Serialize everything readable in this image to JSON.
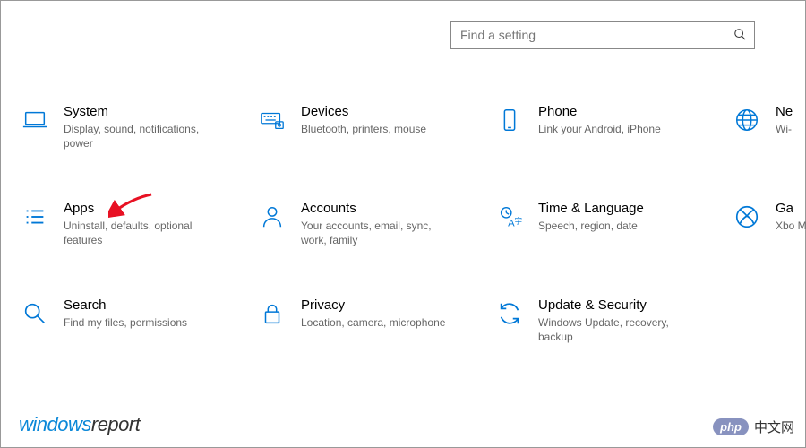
{
  "search": {
    "placeholder": "Find a setting"
  },
  "tiles": [
    {
      "id": "system",
      "title": "System",
      "desc": "Display, sound, notifications, power"
    },
    {
      "id": "devices",
      "title": "Devices",
      "desc": "Bluetooth, printers, mouse"
    },
    {
      "id": "phone",
      "title": "Phone",
      "desc": "Link your Android, iPhone"
    },
    {
      "id": "network",
      "title": "Ne",
      "desc": "Wi-"
    },
    {
      "id": "apps",
      "title": "Apps",
      "desc": "Uninstall, defaults, optional features"
    },
    {
      "id": "accounts",
      "title": "Accounts",
      "desc": "Your accounts, email, sync, work, family"
    },
    {
      "id": "time",
      "title": "Time & Language",
      "desc": "Speech, region, date"
    },
    {
      "id": "gaming",
      "title": "Ga",
      "desc": "Xbo Mo"
    },
    {
      "id": "search",
      "title": "Search",
      "desc": "Find my files, permissions"
    },
    {
      "id": "privacy",
      "title": "Privacy",
      "desc": "Location, camera, microphone"
    },
    {
      "id": "update",
      "title": "Update & Security",
      "desc": "Windows Update, recovery, backup"
    }
  ],
  "annotation": {
    "arrow_target": "apps"
  },
  "branding": {
    "left_a": "windows",
    "left_b": "report",
    "right_pill": "php",
    "right_text": "中文网"
  },
  "colors": {
    "accent": "#0078d7",
    "arrow": "#e81123"
  }
}
